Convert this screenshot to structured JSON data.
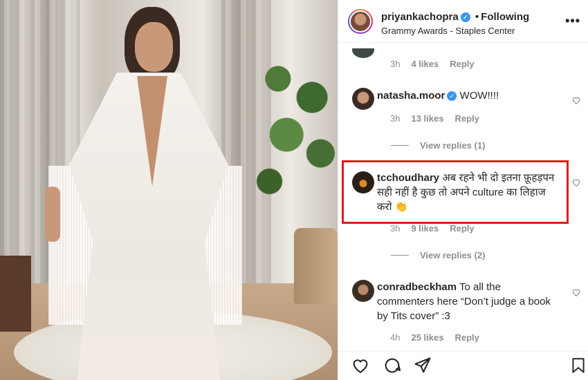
{
  "post": {
    "username": "priyankachopra",
    "verified_mark": "✓",
    "separator": "•",
    "following_label": "Following",
    "location": "Grammy Awards - Staples Center",
    "more_label": "•••"
  },
  "comments": [
    {
      "time": "3h",
      "likes": "4 likes",
      "reply": "Reply"
    },
    {
      "username": "natasha.moor",
      "verified_mark": "✓",
      "text": "WOW!!!!",
      "time": "3h",
      "likes": "13 likes",
      "reply": "Reply",
      "view_replies": "View replies (1)"
    },
    {
      "username": "tcchoudhary",
      "text": "अब रहने भी दो इतना फ़ूहड़पन सही नहीं है कुछ तो अपने culture का लिहाज करो 👏",
      "time": "3h",
      "likes": "9 likes",
      "reply": "Reply",
      "view_replies": "View replies (2)"
    },
    {
      "username": "conradbeckham",
      "text": "To all the commenters here “Don’t judge a book by Tits cover” :3",
      "time": "4h",
      "likes": "25 likes",
      "reply": "Reply"
    }
  ],
  "highlight_color": "#e31b1b",
  "accent_color": "#3897f0",
  "icons": {
    "heart": "heart-icon",
    "comment": "comment-icon",
    "share": "share-icon",
    "bookmark": "bookmark-icon",
    "comment_like": "heart-outline-icon"
  }
}
